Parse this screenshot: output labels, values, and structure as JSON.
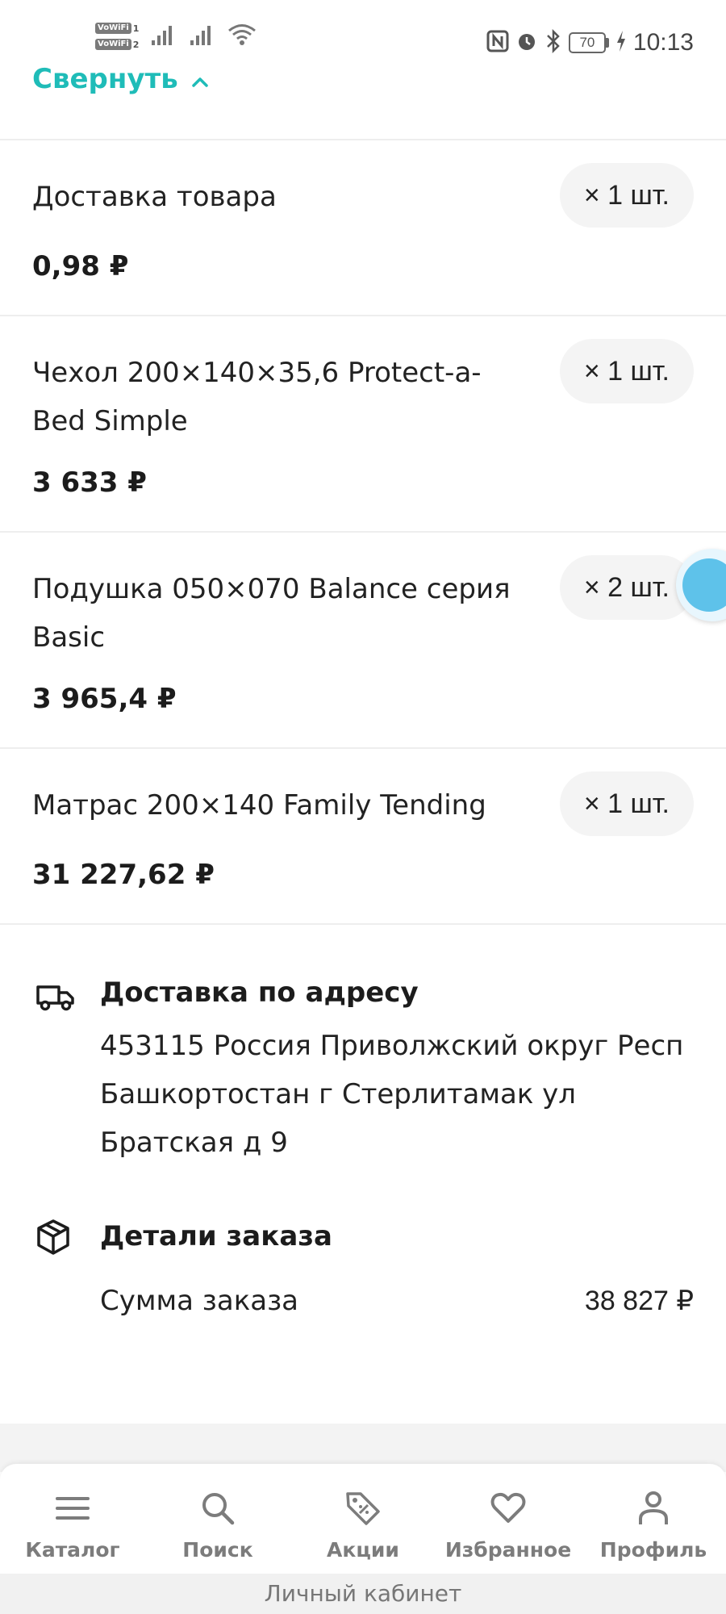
{
  "status_bar": {
    "vowifi_1": "VoWiFi",
    "vowifi_1_sim": "1",
    "vowifi_2": "VoWiFi",
    "vowifi_2_sim": "2",
    "battery": "70",
    "time": "10:13"
  },
  "collapse_label": "Свернуть",
  "items": [
    {
      "name": "Доставка товара",
      "qty": "× 1 шт.",
      "price": "0,98 ₽"
    },
    {
      "name": "Чехол 200×140×35,6 Protect-a-Bed Simple",
      "qty": "× 1 шт.",
      "price": "3 633 ₽"
    },
    {
      "name": "Подушка 050×070 Balance серия Basic",
      "qty": "× 2 шт.",
      "price": "3 965,4 ₽"
    },
    {
      "name": "Матрас 200×140 Family Tending",
      "qty": "× 1 шт.",
      "price": "31 227,62 ₽"
    }
  ],
  "delivery": {
    "title": "Доставка по адресу",
    "address": "453115 Россия Приволжский округ Респ Башкортостан г Стерлитамак ул Братская д 9"
  },
  "order_details": {
    "title": "Детали заказа",
    "sum_label": "Сумма заказа",
    "sum_value": "38 827 ₽"
  },
  "nav": [
    {
      "label": "Каталог",
      "icon": "menu-icon"
    },
    {
      "label": "Поиск",
      "icon": "search-icon"
    },
    {
      "label": "Акции",
      "icon": "tag-icon"
    },
    {
      "label": "Избранное",
      "icon": "heart-icon"
    },
    {
      "label": "Профиль",
      "icon": "profile-icon"
    }
  ],
  "footer_label": "Личный кабинет",
  "colors": {
    "accent": "#1fbcb8",
    "nav_text": "#7c7c7c"
  }
}
